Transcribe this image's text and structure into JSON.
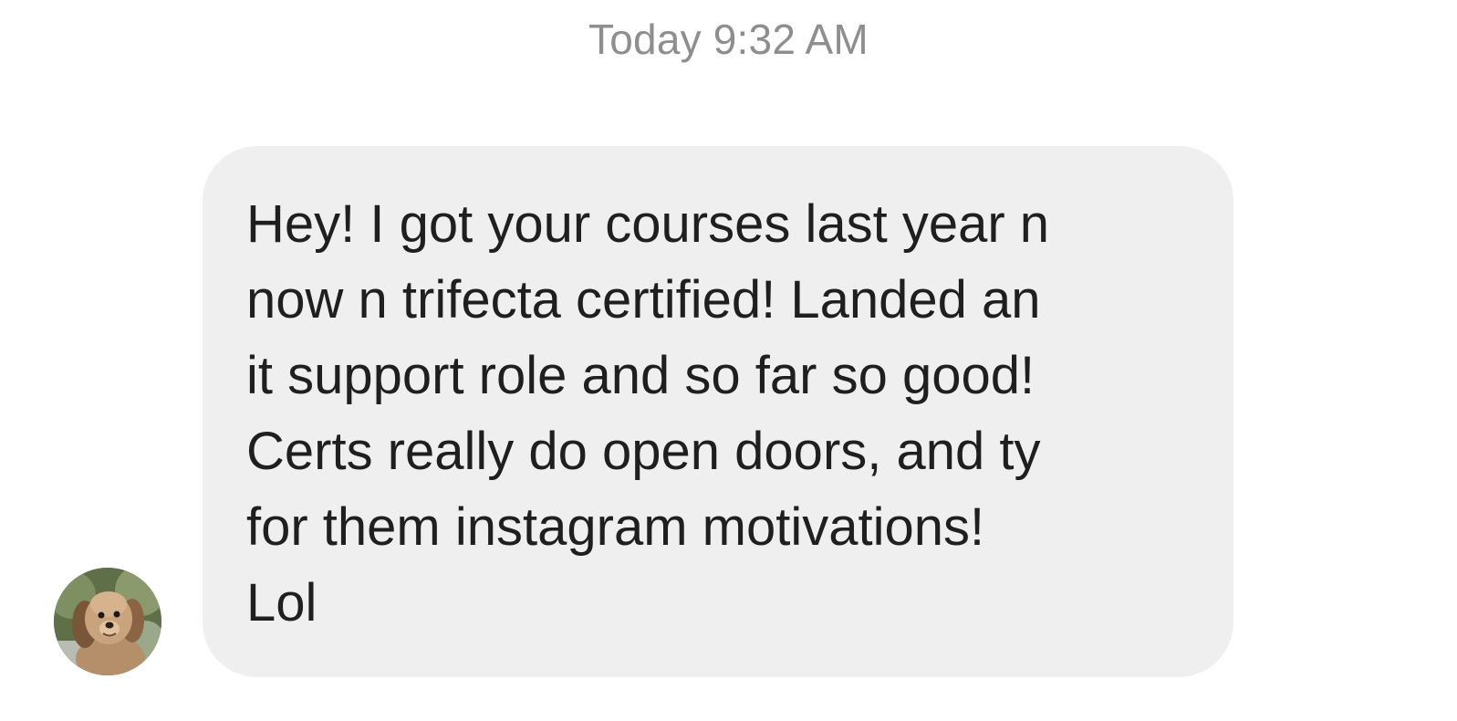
{
  "timestamp": "Today 9:32 AM",
  "message": {
    "text": "Hey! I got your courses last year n\nnow n trifecta certified! Landed an\nit support role and so far so good!\nCerts really do open doors, and ty\nfor them instagram motivations!\nLol",
    "bubble_color": "#efefef",
    "text_color": "#1f1f1f"
  },
  "sender": {
    "avatar_icon": "dog-avatar-icon"
  },
  "colors": {
    "timestamp": "#8e8e8e",
    "background": "#ffffff"
  }
}
